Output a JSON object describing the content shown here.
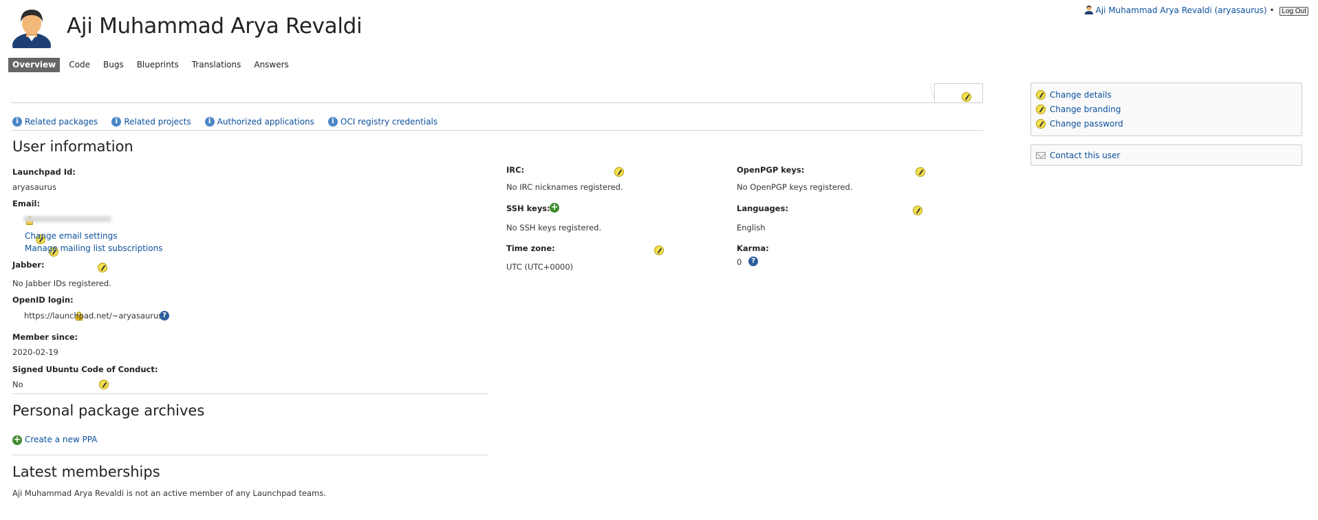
{
  "header": {
    "title": "Aji Muhammad Arya Revaldi",
    "logged_in_user": "Aji Muhammad Arya Revaldi (aryasaurus)",
    "separator": "•",
    "logout_label": "Log Out"
  },
  "nav": {
    "tabs": [
      "Overview",
      "Code",
      "Bugs",
      "Blueprints",
      "Translations",
      "Answers"
    ],
    "active": "Overview"
  },
  "related_links": [
    "Related packages",
    "Related projects",
    "Authorized applications",
    "OCI registry credentials"
  ],
  "user_info": {
    "heading": "User information",
    "launchpad_id_label": "Launchpad Id:",
    "launchpad_id": "aryasaurus",
    "email_label": "Email:",
    "change_email": "Change email settings",
    "manage_mailing": "Manage mailing list subscriptions",
    "jabber_label": "Jabber:",
    "jabber_value": "No Jabber IDs registered.",
    "openid_label": "OpenID login:",
    "openid_value": "https://launchpad.net/~aryasaurus",
    "member_since_label": "Member since:",
    "member_since": "2020-02-19",
    "coc_label": "Signed Ubuntu Code of Conduct:",
    "coc_value": "No",
    "irc_label": "IRC:",
    "irc_value": "No IRC nicknames registered.",
    "ssh_label": "SSH keys:",
    "ssh_value": "No SSH keys registered.",
    "timezone_label": "Time zone:",
    "timezone_value": "UTC (UTC+0000)",
    "openpgp_label": "OpenPGP keys:",
    "openpgp_value": "No OpenPGP keys registered.",
    "languages_label": "Languages:",
    "languages_value": "English",
    "karma_label": "Karma:",
    "karma_value": "0"
  },
  "ppa": {
    "heading": "Personal package archives",
    "create_link": "Create a new PPA"
  },
  "memberships": {
    "heading": "Latest memberships",
    "text": "Aji Muhammad Arya Revaldi is not an active member of any Launchpad teams."
  },
  "sidebar": {
    "actions": [
      "Change details",
      "Change branding",
      "Change password"
    ],
    "contact": "Contact this user"
  },
  "colors": {
    "link": "#0b4f9c",
    "active_tab_bg": "#666666",
    "edit_icon": "#f3e04e",
    "add_icon": "#3f8c2e",
    "info_icon": "#4a86c8"
  }
}
